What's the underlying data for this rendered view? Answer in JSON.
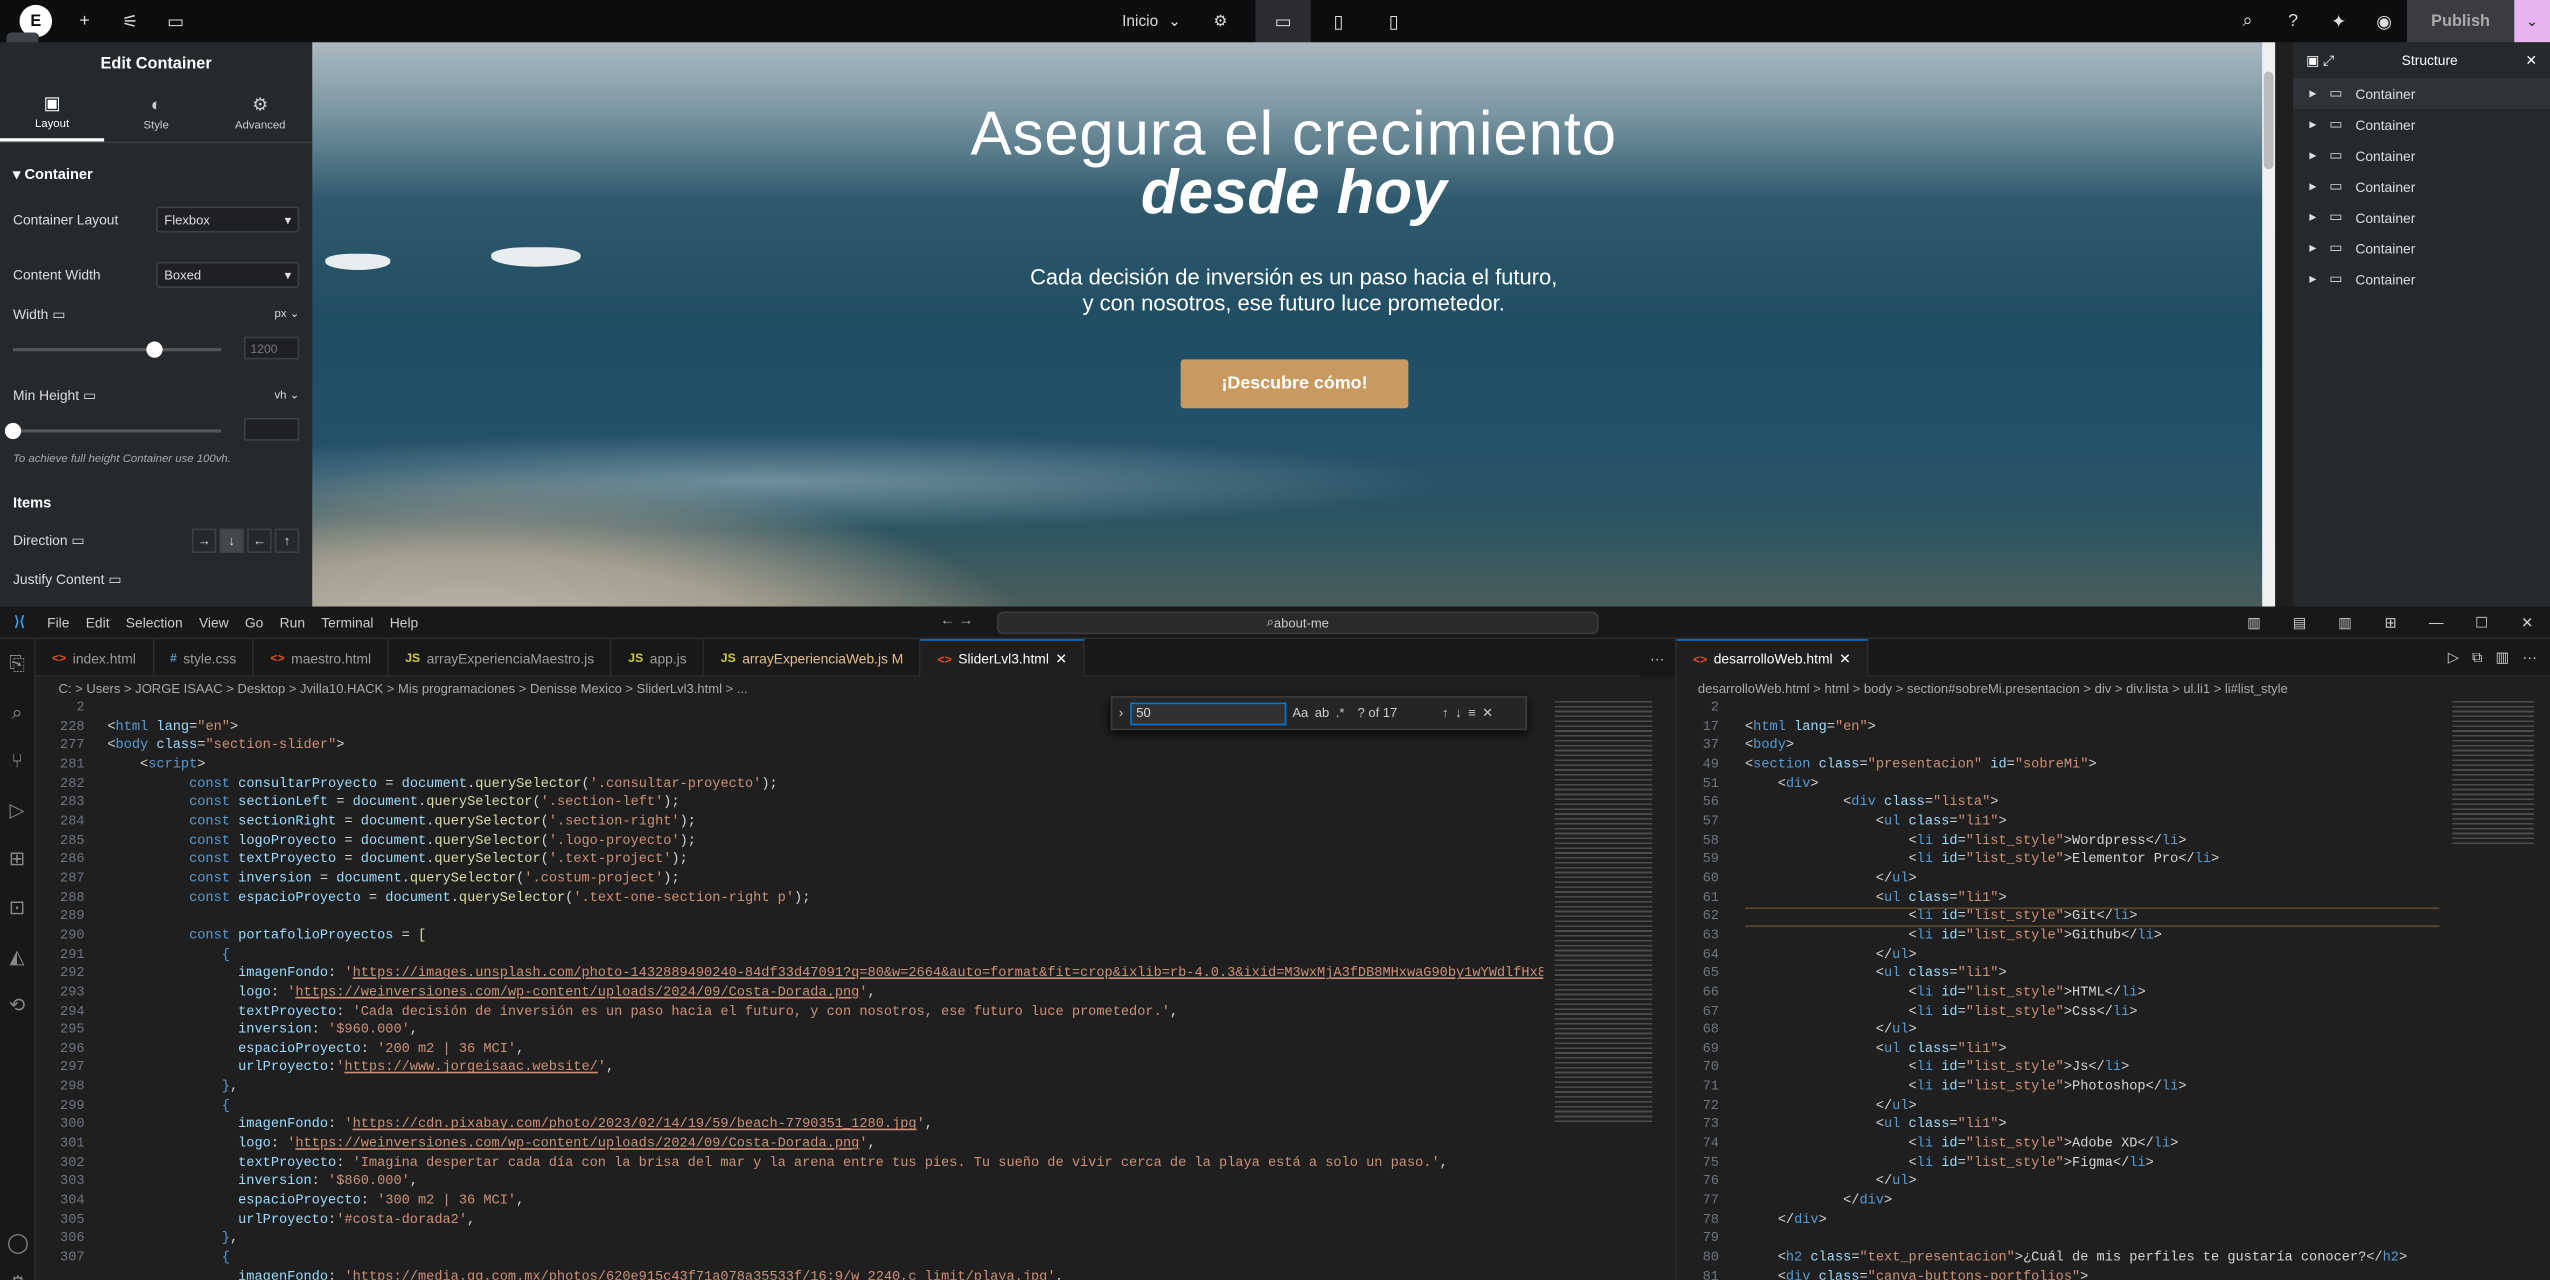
{
  "elementor": {
    "logo": "E",
    "page": "Inicio",
    "publish": "Publish",
    "panel": {
      "title": "Edit Container",
      "tabs": [
        "Layout",
        "Style",
        "Advanced"
      ],
      "section": "Container",
      "container_layout_label": "Container Layout",
      "container_layout_value": "Flexbox",
      "content_width_label": "Content Width",
      "content_width_value": "Boxed",
      "width_label": "Width",
      "width_unit": "px",
      "width_value": "1200",
      "width_slider_fraction": 0.68,
      "min_height_label": "Min Height",
      "min_height_unit": "vh",
      "min_height_slider_fraction": 0.0,
      "note": "To achieve full height Container use 100vh.",
      "items": "Items",
      "direction_label": "Direction",
      "justify_label": "Justify Content"
    },
    "hero": {
      "line1": "Asegura el crecimiento",
      "line2": "desde hoy",
      "sub1": "Cada decisión de inversión es un paso hacia el futuro,",
      "sub2": "y con nosotros, ese futuro luce prometedor.",
      "cta": "¡Descubre cómo!"
    },
    "structure": {
      "title": "Structure",
      "items": [
        "Container",
        "Container",
        "Container",
        "Container",
        "Container",
        "Container",
        "Container"
      ]
    }
  },
  "vscode": {
    "menu": [
      "File",
      "Edit",
      "Selection",
      "View",
      "Go",
      "Run",
      "Terminal",
      "Help"
    ],
    "search": "about-me",
    "tabs_left": [
      {
        "icon": "<>",
        "color": "#e44d26",
        "name": "index.html",
        "active": false
      },
      {
        "icon": "#",
        "color": "#569cd6",
        "name": "style.css",
        "active": false
      },
      {
        "icon": "<>",
        "color": "#e44d26",
        "name": "maestro.html",
        "active": false
      },
      {
        "icon": "JS",
        "color": "#cbcb41",
        "name": "arrayExperienciaMaestro.js",
        "active": false
      },
      {
        "icon": "JS",
        "color": "#cbcb41",
        "name": "app.js",
        "active": false
      },
      {
        "icon": "JS",
        "color": "#cbcb41",
        "name": "arrayExperienciaWeb.js M",
        "active": false
      },
      {
        "icon": "<>",
        "color": "#e44d26",
        "name": "SliderLvl3.html",
        "active": true
      }
    ],
    "tab_right": "desarrolloWeb.html",
    "breadcrumb_left": "C: > Users > JORGE ISAAC > Desktop > Jvilla10.HACK > Mis programaciones > Denisse Mexico > SliderLvl3.html > ...",
    "breadcrumb_right": "desarrolloWeb.html > html > body > section#sobreMi.presentacion > div > div.lista > ul.li1 > li#list_style",
    "find": {
      "query": "50",
      "count": "? of 17"
    },
    "left_lines": [
      "2",
      "228",
      "277",
      "281",
      "282",
      "283",
      "284",
      "285",
      "286",
      "287",
      "288",
      "289",
      "290",
      "291",
      "292",
      "293",
      "294",
      "295",
      "296",
      "297",
      "298",
      "299",
      "300",
      "301",
      "302",
      "303",
      "304",
      "305",
      "306",
      "307"
    ],
    "right_lines": [
      "2",
      "17",
      "37",
      "49",
      "51",
      "56",
      "57",
      "58",
      "59",
      "60",
      "61",
      "62",
      "63",
      "64",
      "65",
      "66",
      "67",
      "68",
      "69",
      "70",
      "71",
      "72",
      "73",
      "74",
      "75",
      "76",
      "77",
      "78",
      "79",
      "80",
      "81"
    ]
  }
}
